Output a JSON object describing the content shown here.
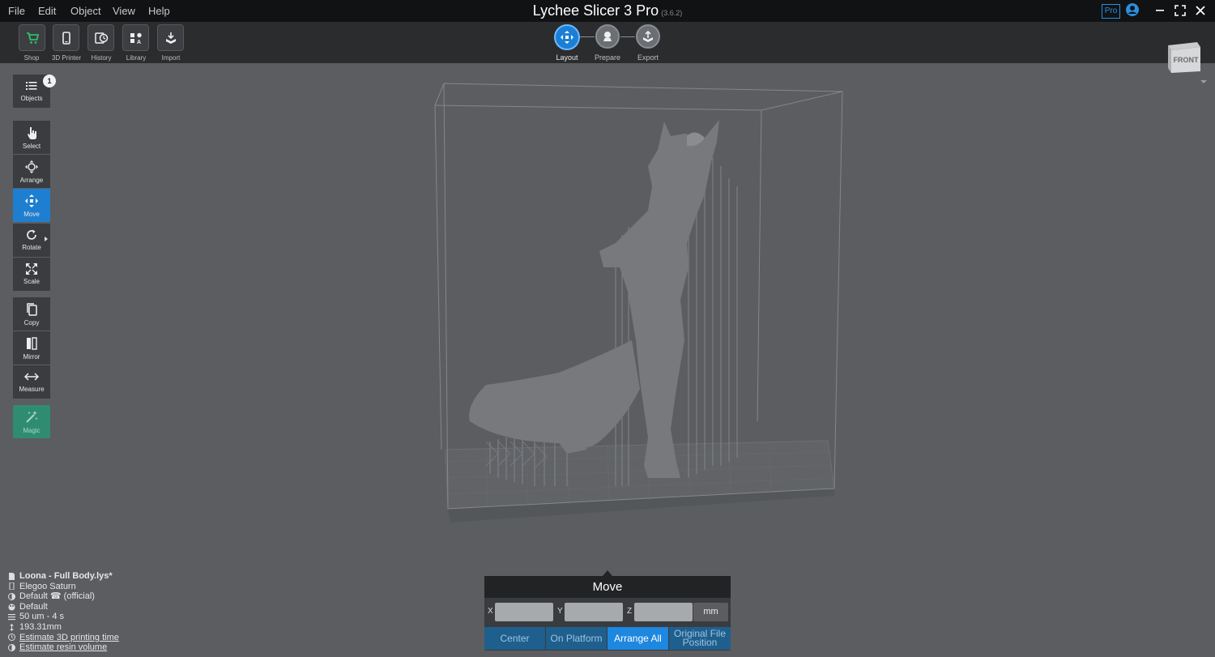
{
  "menu": {
    "file": "File",
    "edit": "Edit",
    "object": "Object",
    "view": "View",
    "help": "Help"
  },
  "app": {
    "title": "Lychee Slicer 3 Pro",
    "version": "(3.6.2)",
    "pro_badge": "Pro"
  },
  "toolbar": {
    "shop": "Shop",
    "printer": "3D Printer",
    "history": "History",
    "library": "Library",
    "import": "Import"
  },
  "steps": {
    "layout": "Layout",
    "prepare": "Prepare",
    "export": "Export"
  },
  "left_panel": {
    "objects": "Objects",
    "objects_count": "1",
    "select": "Select",
    "arrange": "Arrange",
    "move": "Move",
    "rotate": "Rotate",
    "scale": "Scale",
    "copy": "Copy",
    "mirror": "Mirror",
    "measure": "Measure",
    "magic": "Magic"
  },
  "nav_cube": {
    "face": "FRONT"
  },
  "info": {
    "file_name": "Loona - Full Body.lys*",
    "printer": "Elegoo Saturn",
    "resin": "Default ☎ (official)",
    "profile": "Default",
    "layer": "50 um - 4 s",
    "height": "193.31mm",
    "estimate_time": "Estimate 3D printing time",
    "estimate_resin": "Estimate resin volume"
  },
  "move_panel": {
    "title": "Move",
    "x_label": "X",
    "y_label": "Y",
    "z_label": "Z",
    "x_value": "",
    "y_value": "",
    "z_value": "",
    "unit": "mm",
    "center": "Center",
    "on_platform": "On Platform",
    "arrange_all": "Arrange All",
    "original_line1": "Original File",
    "original_line2": "Position"
  },
  "colors": {
    "accent": "#1e7fd0",
    "magic": "#2f8c70",
    "viewport": "#5b5d60",
    "toolbar": "#2b2c2e",
    "titlebar": "#111213"
  }
}
